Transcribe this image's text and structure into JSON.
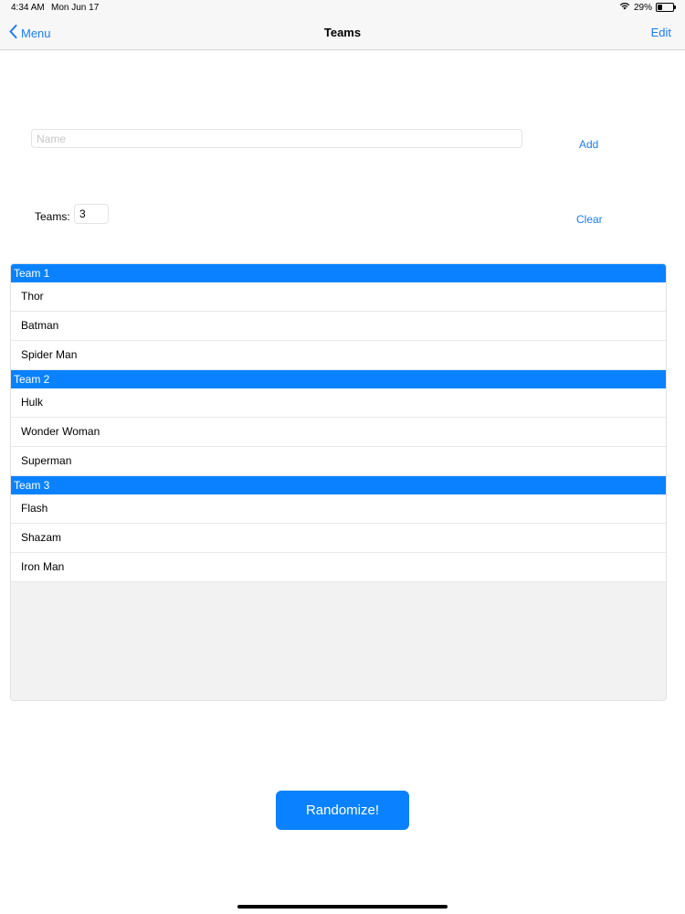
{
  "status": {
    "time": "4:34 AM",
    "date": "Mon Jun 17",
    "battery": "29%",
    "battery_level": 0.29
  },
  "nav": {
    "back_label": "Menu",
    "title": "Teams",
    "edit_label": "Edit"
  },
  "form": {
    "name_placeholder": "Name",
    "add_label": "Add",
    "teams_label": "Teams:",
    "teams_value": "3",
    "clear_label": "Clear"
  },
  "teams": [
    {
      "title": "Team 1",
      "members": [
        "Thor",
        "Batman",
        "Spider Man"
      ]
    },
    {
      "title": "Team 2",
      "members": [
        "Hulk",
        "Wonder Woman",
        "Superman"
      ]
    },
    {
      "title": "Team 3",
      "members": [
        "Flash",
        "Shazam",
        "Iron Man"
      ]
    }
  ],
  "randomize_label": "Randomize!",
  "colors": {
    "accent": "#1a7cf2",
    "header_bg": "#0a82ff"
  }
}
